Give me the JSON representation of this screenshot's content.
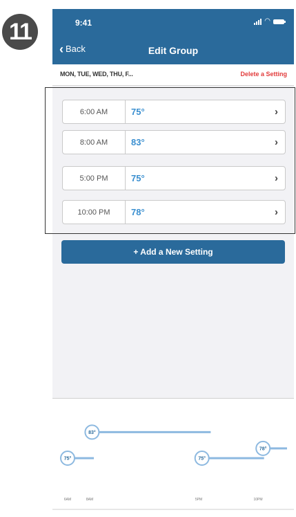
{
  "step_number": "11",
  "status_bar": {
    "time": "9:41"
  },
  "header": {
    "back_label": "Back",
    "title": "Edit Group"
  },
  "days_bar": {
    "days": "MON, TUE, WED, THU, F...",
    "delete_label": "Delete a Setting"
  },
  "settings": [
    {
      "time": "6:00 AM",
      "temp": "75°"
    },
    {
      "time": "8:00 AM",
      "temp": "83°"
    },
    {
      "time": "5:00 PM",
      "temp": "75°"
    },
    {
      "time": "10:00 PM",
      "temp": "78°"
    }
  ],
  "add_button_label": "+ Add a New Setting",
  "colors": {
    "header_blue": "#2a6a9b",
    "temp_blue": "#3a8fd0",
    "delete_red": "#e23b3b",
    "graph_line": "#8db9e0"
  },
  "icons": [
    "chevron-left-icon",
    "chevron-right-icon",
    "signal-icon",
    "wifi-icon",
    "battery-icon"
  ],
  "schedule_graph": {
    "points": [
      {
        "label": "75°",
        "hour": 6,
        "temp": 75
      },
      {
        "label": "83°",
        "hour": 8,
        "temp": 83
      },
      {
        "label": "75°",
        "hour": 17,
        "temp": 75
      },
      {
        "label": "78°",
        "hour": 22,
        "temp": 78
      }
    ],
    "tick_labels": [
      "6AM",
      "8AM",
      "5PM",
      "10PM"
    ]
  }
}
